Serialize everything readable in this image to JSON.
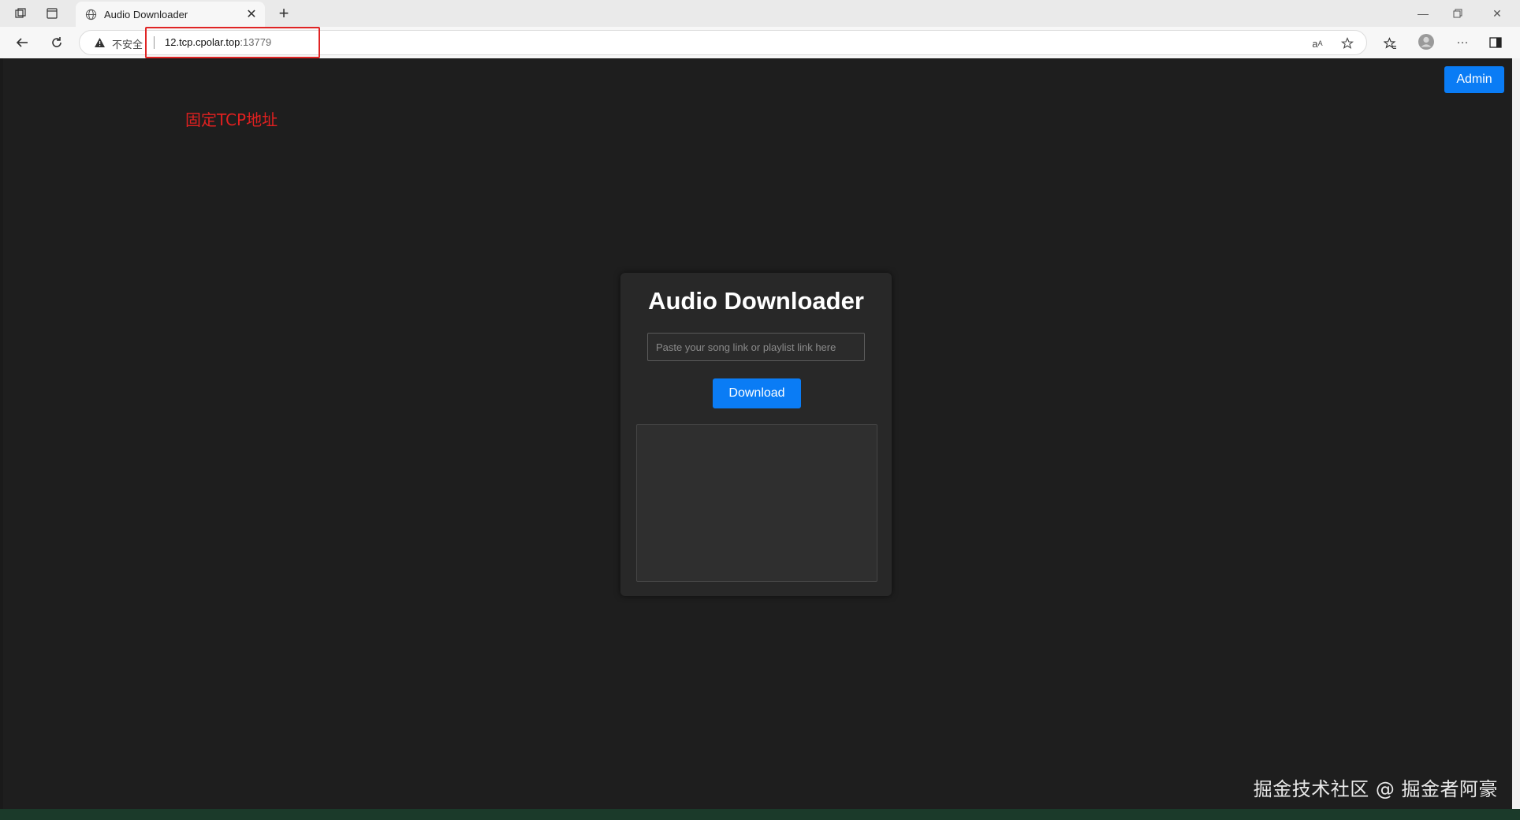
{
  "browser": {
    "tab_title": "Audio Downloader",
    "insecure_label": "不安全",
    "url_host": "12.tcp.cpolar.top",
    "url_port": ":13779"
  },
  "page": {
    "admin_label": "Admin",
    "annotation": "固定TCP地址",
    "title": "Audio Downloader",
    "input_placeholder": "Paste your song link or playlist link here",
    "input_value": "",
    "download_label": "Download",
    "watermark": "掘金技术社区 @ 掘金者阿豪"
  },
  "colors": {
    "accent": "#0a7cf5",
    "annotation": "#e02020",
    "page_background": "#1e1e1e",
    "card_background": "#282828"
  }
}
